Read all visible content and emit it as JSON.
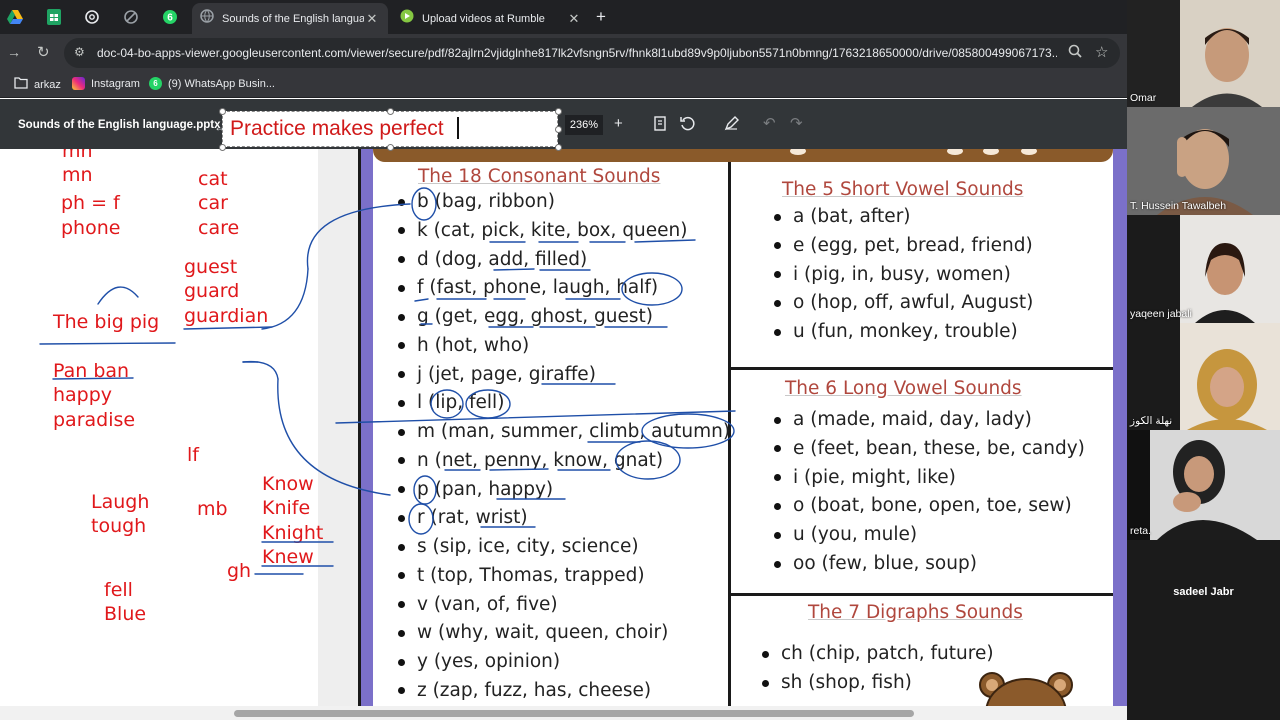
{
  "browser": {
    "tabs": [
      {
        "title": "Sounds of the English language.pptx",
        "active": true
      },
      {
        "title": "Upload videos at Rumble",
        "active": false
      }
    ],
    "pinned_badge": "6",
    "url": "doc-04-bo-apps-viewer.googleusercontent.com/viewer/secure/pdf/82ajlrn2vjidglnhe817lk2vfsngn5rv/fhnk8l1ubd89v9p0ljubon5571n0bmng/1763218650000/drive/085800499067173...",
    "bookmarks": [
      {
        "label": "arkaz",
        "icon": "folder-icon"
      },
      {
        "label": "Instagram",
        "icon": "instagram-icon"
      },
      {
        "label": "(9) WhatsApp Busin...",
        "icon": "whatsapp-icon",
        "badge": "6"
      }
    ]
  },
  "pdf": {
    "filename": "Sounds of the English language.pptx",
    "zoom": "236%",
    "textbox_text": "Practice makes perfect"
  },
  "notes": [
    "mn",
    "ph = f",
    "phone",
    "cat",
    "car",
    "care",
    "guest",
    "guard",
    "guardian",
    "The big pig",
    "Pan ban",
    "happy",
    "paradise",
    "lf",
    "Laugh",
    "tough",
    "mb",
    "Know",
    "Knife",
    "Knight",
    "Knew",
    "gh",
    "fell",
    "Blue",
    "mn"
  ],
  "worksheet": {
    "consonants": {
      "title": "The 18 Consonant Sounds",
      "items": [
        "b (bag, ribbon)",
        "k (cat, pick, kite, box, queen)",
        "d (dog, add, filled)",
        "f (fast, phone, laugh, half)",
        "g (get, egg, ghost, guest)",
        "h (hot, who)",
        "j (jet, page, giraffe)",
        "l (lip, fell)",
        "m (man, summer, climb, autumn)",
        "n (net, penny, know, gnat)",
        "p (pan, happy)",
        "r (rat, wrist)",
        "s (sip, ice, city, science)",
        "t (top, Thomas, trapped)",
        "v (van, of, five)",
        "w (why, wait, queen, choir)",
        "y (yes, opinion)",
        "z (zap, fuzz, has, cheese)"
      ]
    },
    "short_vowels": {
      "title": "The 5 Short Vowel Sounds",
      "items": [
        "a (bat, after)",
        "e (egg, pet, bread, friend)",
        "i (pig, in, busy, women)",
        "o (hop, off, awful, August)",
        "u (fun, monkey, trouble)"
      ]
    },
    "long_vowels": {
      "title": "The 6 Long Vowel Sounds",
      "items": [
        "a (made, maid, day, lady)",
        "e (feet, bean, these, be, candy)",
        "i (pie, might, like)",
        "o (boat, bone, open, toe, sew)",
        "u (you, mule)",
        "oo (few, blue, soup)"
      ]
    },
    "digraphs": {
      "title": "The 7 Digraphs Sounds",
      "items": [
        "ch (chip, patch, future)",
        "sh (shop, fish)"
      ]
    }
  },
  "participants": [
    {
      "name": "Omar"
    },
    {
      "name": "T. Hussein Tawalbeh"
    },
    {
      "name": "yaqeen jabali"
    },
    {
      "name": "نهلة الكوز"
    },
    {
      "name": "reta."
    },
    {
      "name": "sadeel Jabr"
    }
  ],
  "colors": {
    "ink_red": "#e0181b",
    "ink_blue": "#1f4fa8",
    "title_red": "#b0473d",
    "sheet_purple": "#7b70c9",
    "sheet_brown": "#8a5a2a"
  }
}
